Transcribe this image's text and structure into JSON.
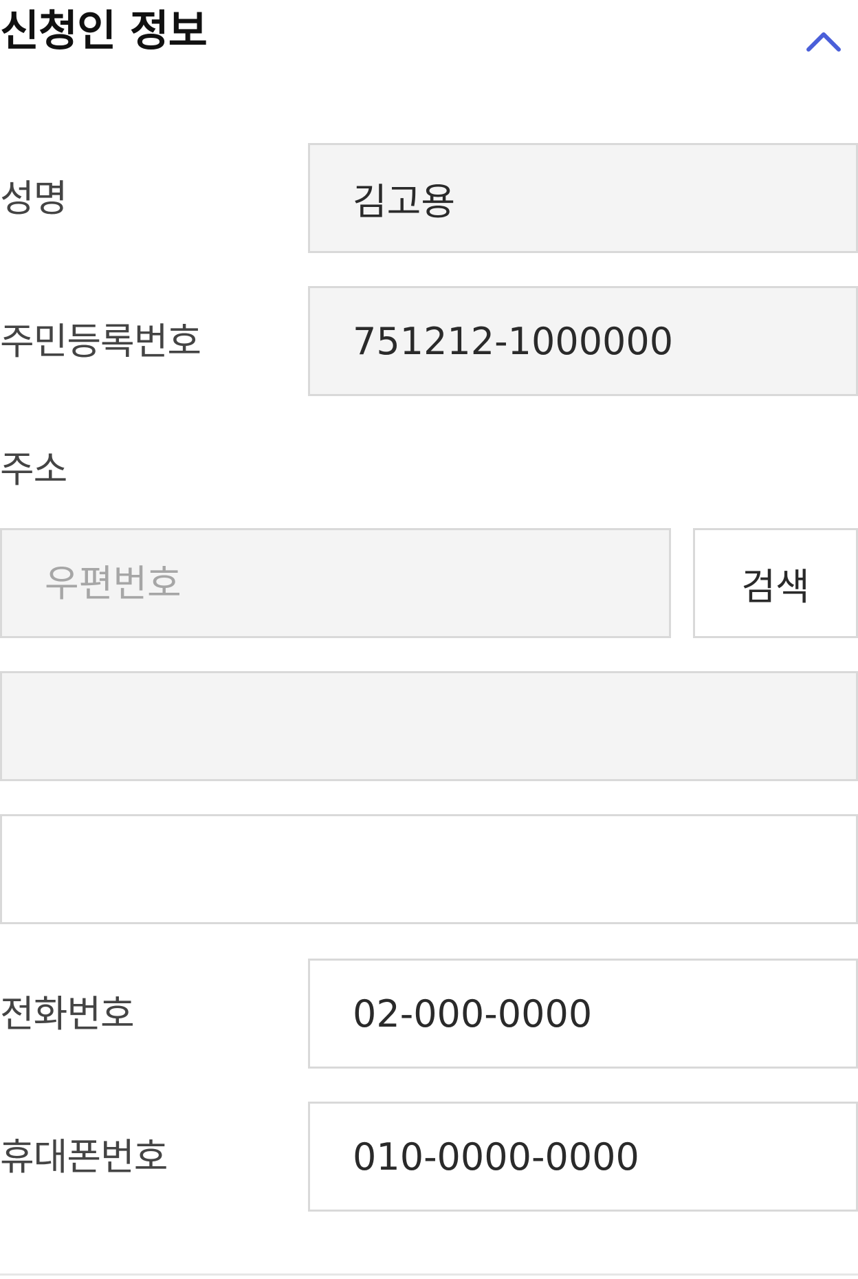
{
  "section": {
    "title": "신청인 정보",
    "collapse_icon": "chevron-up-icon",
    "accent_color": "#4a5fd9"
  },
  "form": {
    "name": {
      "label": "성명",
      "value": "김고용"
    },
    "resident_number": {
      "label": "주민등록번호",
      "value": "751212-1000000"
    },
    "address": {
      "label": "주소",
      "postal_code_placeholder": "우편번호",
      "postal_code_value": "",
      "search_button_label": "검색",
      "address_line1_value": "",
      "address_line2_value": ""
    },
    "phone": {
      "label": "전화번호",
      "value": "02-000-0000"
    },
    "mobile": {
      "label": "휴대폰번호",
      "value": "010-0000-0000"
    }
  }
}
